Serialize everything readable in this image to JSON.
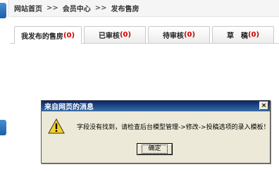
{
  "breadcrumb": {
    "home": "网站首页",
    "sep1": ">>",
    "member_center": "会员中心",
    "sep2": ">>",
    "current": "发布售房"
  },
  "tabs": [
    {
      "label": "我发布的售房",
      "count": "(0)"
    },
    {
      "label": "已审核",
      "count": "(0)"
    },
    {
      "label": "待审核",
      "count": "(0)"
    },
    {
      "label": "草　稿",
      "count": "(0)"
    }
  ],
  "dialog": {
    "title": "来自网页的消息",
    "close_icon": "×",
    "message": "字段没有找到，请检查后台模型管理->修改->投稿选项的录入模板！",
    "ok_label": "确定"
  },
  "colors": {
    "title_bar": "#0a246a",
    "dialog_bg": "#ece9d8",
    "count_red": "#cc0000",
    "sidebar_blue": "#1a5fa8"
  }
}
